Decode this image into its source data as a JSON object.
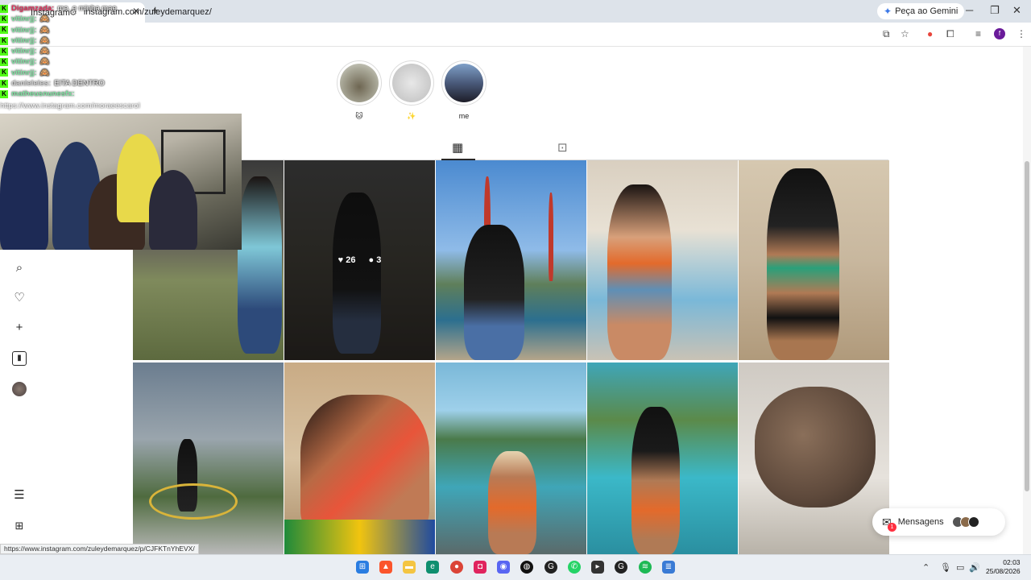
{
  "browser": {
    "tab_title": "Instagram",
    "url": "instagram.com/zuleydemarquez/",
    "gemini_label": "Peça ao Gemini",
    "profile_initial": "f",
    "status_url": "https://www.instagram.com/zuleydemarquez/p/CJFKTnYhEVX/"
  },
  "chat": {
    "first_user": "Digamzada:",
    "first_msg": "me, e minha mae",
    "lines": [
      {
        "user": "vitinrjj:",
        "msg": "🙈"
      },
      {
        "user": "vitinrjj:",
        "msg": "🙈"
      },
      {
        "user": "vitinrjj:",
        "msg": "🙈"
      },
      {
        "user": "vitinrjj:",
        "msg": "🙈"
      },
      {
        "user": "vitinrjj:",
        "msg": "🙈"
      },
      {
        "user": "vitinrjj:",
        "msg": "🙈"
      },
      {
        "user": "danieleies:",
        "msg": "EITA DENTRO"
      },
      {
        "user": "matheusnunesfx:",
        "msg": ""
      }
    ],
    "link": "https://www.instagram.com/moraeescarol"
  },
  "highlights": [
    {
      "label": "🐱",
      "color": "#8a8d7d"
    },
    {
      "label": "✨",
      "color": "#cfcfcf"
    },
    {
      "label": "me",
      "color": "#4a5a7a"
    }
  ],
  "posts": [
    {
      "bg": "#5a3b2a",
      "likes": "",
      "comments": ""
    },
    {
      "bg": "#3b3a34",
      "likes": "26",
      "comments": "3"
    },
    {
      "bg": "#4b8ad0",
      "likes": "",
      "comments": ""
    },
    {
      "bg": "#d9cfc0",
      "likes": "",
      "comments": ""
    },
    {
      "bg": "#c8b79e",
      "likes": "",
      "comments": ""
    },
    {
      "bg": "#6b7d8f",
      "likes": "",
      "comments": ""
    },
    {
      "bg": "#c9ab85",
      "likes": "",
      "comments": ""
    },
    {
      "bg": "#7ab8d8",
      "likes": "",
      "comments": ""
    },
    {
      "bg": "#3fa6b8",
      "likes": "",
      "comments": ""
    },
    {
      "bg": "#cfcac3",
      "likes": "",
      "comments": ""
    }
  ],
  "messages": {
    "label": "Mensagens",
    "badge": "1"
  },
  "taskbar": {
    "time": "02:03",
    "date": "25/08/2026"
  },
  "icons": {
    "sidebar": [
      "search-icon",
      "heart-icon",
      "plus-icon",
      "insights-icon",
      "avatar",
      "menu-icon",
      "more-apps-icon"
    ]
  }
}
